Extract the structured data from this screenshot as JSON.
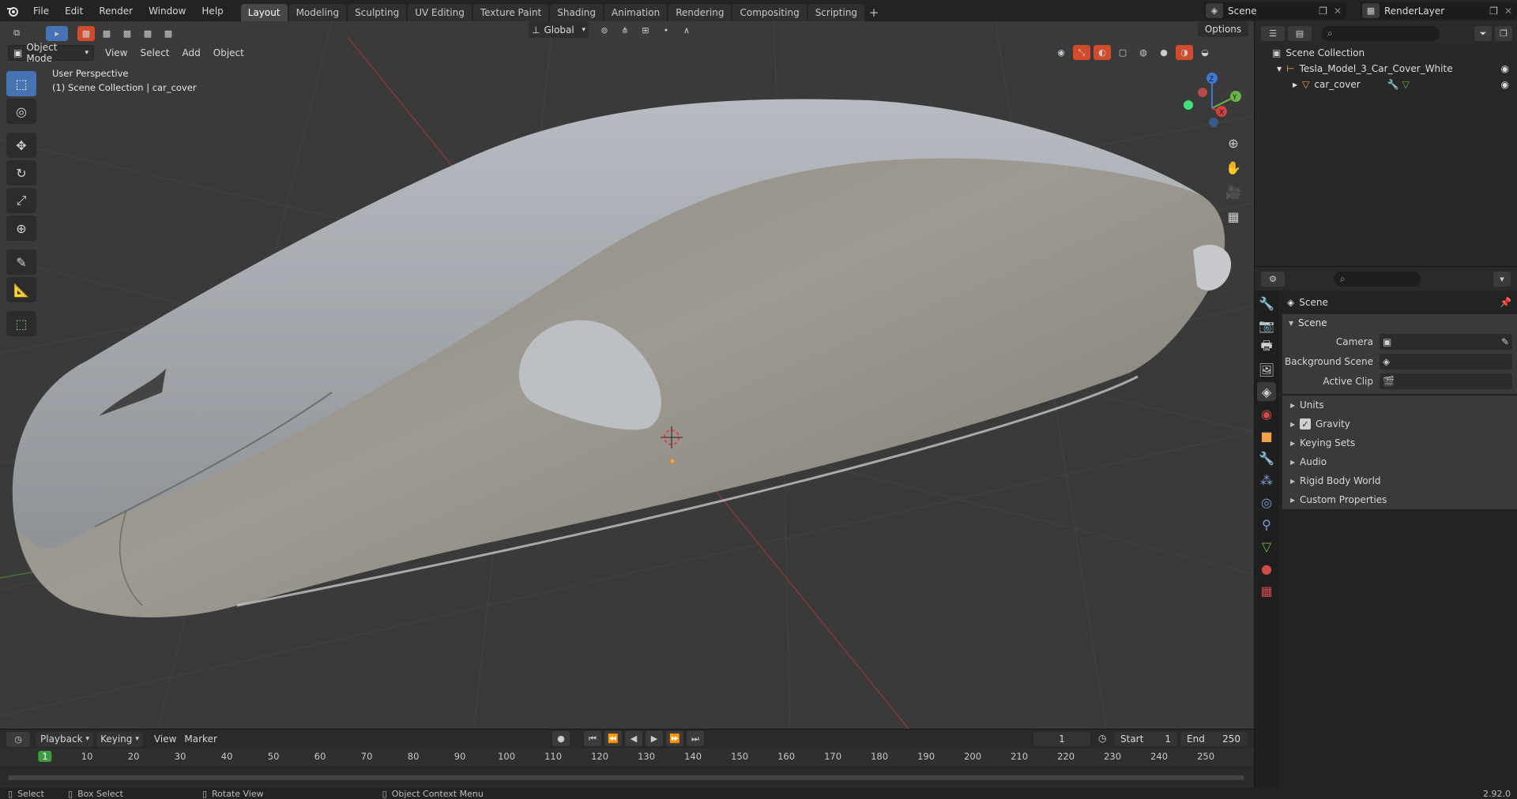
{
  "menu": {
    "items": [
      "File",
      "Edit",
      "Render",
      "Window",
      "Help"
    ]
  },
  "workspaces": {
    "tabs": [
      "Layout",
      "Modeling",
      "Sculpting",
      "UV Editing",
      "Texture Paint",
      "Shading",
      "Animation",
      "Rendering",
      "Compositing",
      "Scripting"
    ],
    "active": "Layout"
  },
  "scene_selector": {
    "value": "Scene"
  },
  "renderlayer_selector": {
    "value": "RenderLayer"
  },
  "viewport": {
    "mode": "Object Mode",
    "menus": [
      "View",
      "Select",
      "Add",
      "Object"
    ],
    "transform_orientation": "Global",
    "options_label": "Options",
    "info_line1": "User Perspective",
    "info_line2": "(1) Scene Collection | car_cover"
  },
  "outliner": {
    "root": "Scene Collection",
    "collection": "Tesla_Model_3_Car_Cover_White",
    "object": "car_cover"
  },
  "properties": {
    "header": "Scene",
    "panel_title": "Scene",
    "camera_label": "Camera",
    "bg_scene_label": "Background Scene",
    "active_clip_label": "Active Clip",
    "sections": [
      "Units",
      "Gravity",
      "Keying Sets",
      "Audio",
      "Rigid Body World",
      "Custom Properties"
    ]
  },
  "timeline": {
    "menus": [
      "Playback",
      "Keying",
      "View",
      "Marker"
    ],
    "current_frame": "1",
    "start_label": "Start",
    "start_value": "1",
    "end_label": "End",
    "end_value": "250",
    "ruler_marks": [
      "1",
      "10",
      "20",
      "30",
      "40",
      "50",
      "60",
      "70",
      "80",
      "90",
      "100",
      "110",
      "120",
      "130",
      "140",
      "150",
      "160",
      "170",
      "180",
      "190",
      "200",
      "210",
      "220",
      "230",
      "240",
      "250"
    ]
  },
  "statusbar": {
    "select": "Select",
    "box_select": "Box Select",
    "rotate_view": "Rotate View",
    "context_menu": "Object Context Menu",
    "version": "2.92.0"
  },
  "colors": {
    "accent": "#4772b3",
    "active_frame": "#3d9e3d"
  }
}
